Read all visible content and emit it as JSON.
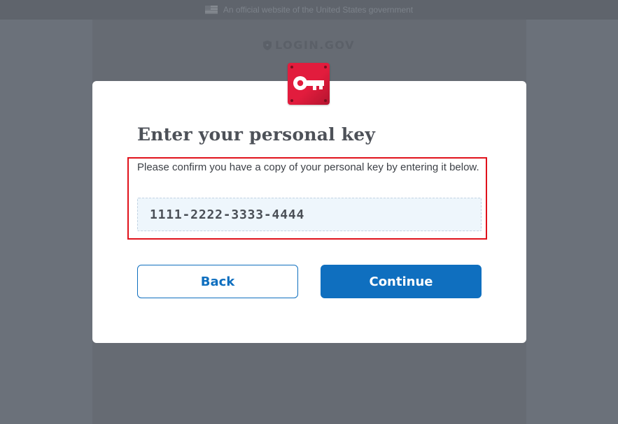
{
  "gov_banner": {
    "text": "An official website of the United States government",
    "icon": "us-flag-icon"
  },
  "brand": {
    "name": "LOGIN.GOV",
    "icon": "shield-icon"
  },
  "modal": {
    "badge_icon": "key-icon",
    "title": "Enter your personal key",
    "instructions": "Please confirm you have a copy of your personal key by entering it below.",
    "personal_key_input": {
      "value": "1111-2222-3333-4444"
    },
    "back_label": "Back",
    "continue_label": "Continue"
  },
  "colors": {
    "overlay": "#6b717a",
    "accent_blue": "#0f6fbf",
    "badge_red": "#e21c3d",
    "highlight_red": "#e0121b",
    "input_background": "#eef6fc"
  }
}
